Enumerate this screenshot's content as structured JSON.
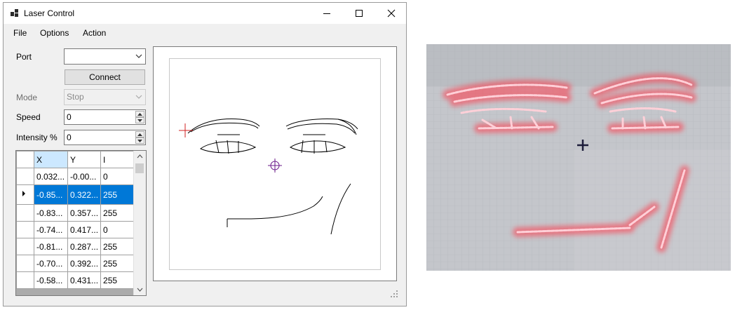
{
  "window": {
    "title": "Laser Control"
  },
  "menu": [
    "File",
    "Options",
    "Action"
  ],
  "controls": {
    "port_label": "Port",
    "port_value": "",
    "connect_label": "Connect",
    "mode_label": "Mode",
    "mode_value": "Stop",
    "speed_label": "Speed",
    "speed_value": "0",
    "intensity_label": "Intensity %",
    "intensity_value": "0"
  },
  "grid": {
    "columns": [
      "X",
      "Y",
      "I"
    ],
    "rows": [
      [
        "0.032...",
        "-0.00...",
        "0"
      ],
      [
        "-0.85...",
        "0.322...",
        "255"
      ],
      [
        "-0.83...",
        "0.357...",
        "255"
      ],
      [
        "-0.74...",
        "0.417...",
        "0"
      ],
      [
        "-0.81...",
        "0.287...",
        "255"
      ],
      [
        "-0.70...",
        "0.392...",
        "255"
      ],
      [
        "-0.58...",
        "0.431...",
        "255"
      ]
    ],
    "selected_row": 1
  },
  "colors": {
    "selection": "#0078d7",
    "cursor_red": "#d02020",
    "cursor_purple": "#6a1a8a",
    "laser": "#ff4a5a"
  },
  "icons": {
    "minimize": "minimize-icon",
    "maximize": "maximize-icon",
    "close": "close-icon",
    "dropdown": "chevron-down-icon",
    "row_pointer": "row-pointer-icon",
    "resize_grip": "resize-grip-icon"
  }
}
